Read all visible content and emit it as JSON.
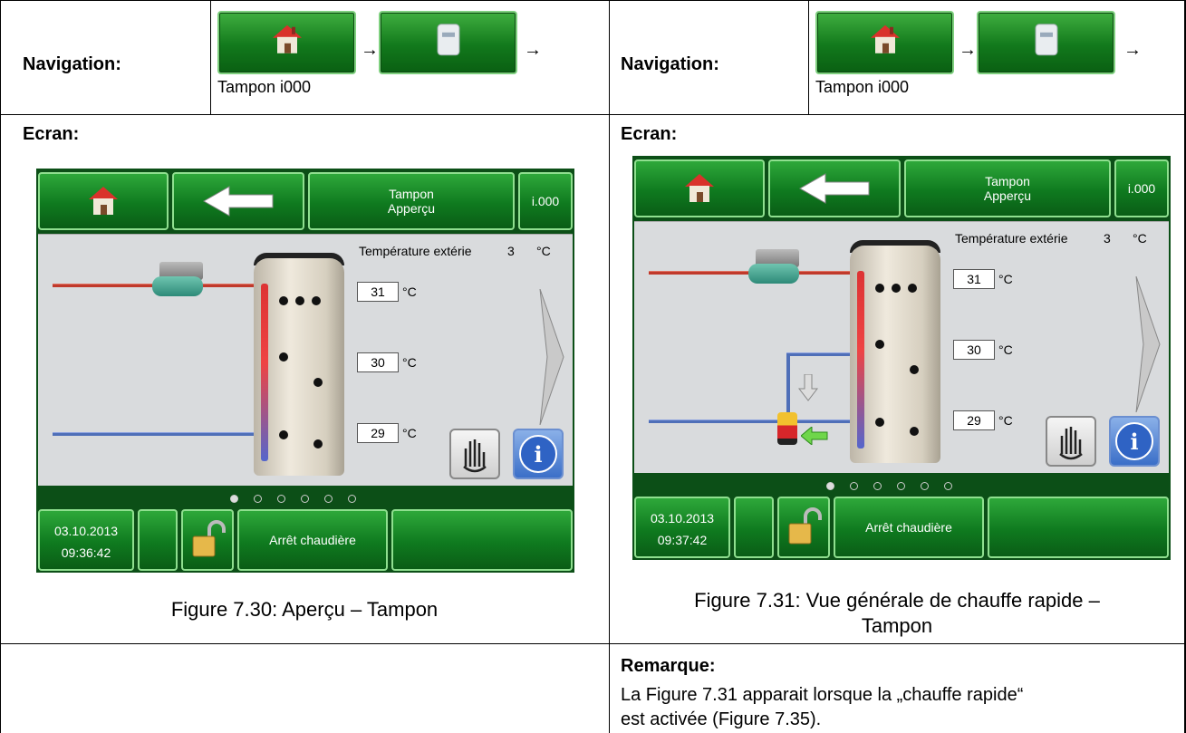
{
  "navigation": {
    "label": "Navigation:",
    "arrow": "→",
    "target": "Tampon i000",
    "home_icon": "home-icon",
    "buffer_icon": "buffer-tank-icon"
  },
  "screen_label": "Ecran:",
  "screens": [
    {
      "header_title_line1": "Tampon",
      "header_title_line2": "Apperçu",
      "header_code": "i.000",
      "ext_temp_label": "Température extérie",
      "ext_temp_value": "3",
      "ext_temp_unit": "°C",
      "temps": [
        "31",
        "30",
        "29"
      ],
      "temp_unit": "°C",
      "date": "03.10.2013",
      "time": "09:36:42",
      "status": "Arrêt chaudière"
    },
    {
      "header_title_line1": "Tampon",
      "header_title_line2": "Apperçu",
      "header_code": "i.000",
      "ext_temp_label": "Température extérie",
      "ext_temp_value": "3",
      "ext_temp_unit": "°C",
      "temps": [
        "31",
        "30",
        "29"
      ],
      "temp_unit": "°C",
      "date": "03.10.2013",
      "time": "09:37:42",
      "status": "Arrêt chaudière"
    }
  ],
  "captions": {
    "left": "Figure 7.30: Aperçu – Tampon",
    "right_line1": "Figure 7.31: Vue générale de chauffe rapide –",
    "right_line2": "Tampon"
  },
  "remark": {
    "title": "Remarque:",
    "line1": "La Figure 7.31 apparait lorsque la „chauffe rapide“",
    "line2": "est activée (Figure 7.35)."
  },
  "colors": {
    "button_green": "#12791c",
    "pipe_red": "#c0392b",
    "pipe_blue": "#4f6fb8"
  }
}
